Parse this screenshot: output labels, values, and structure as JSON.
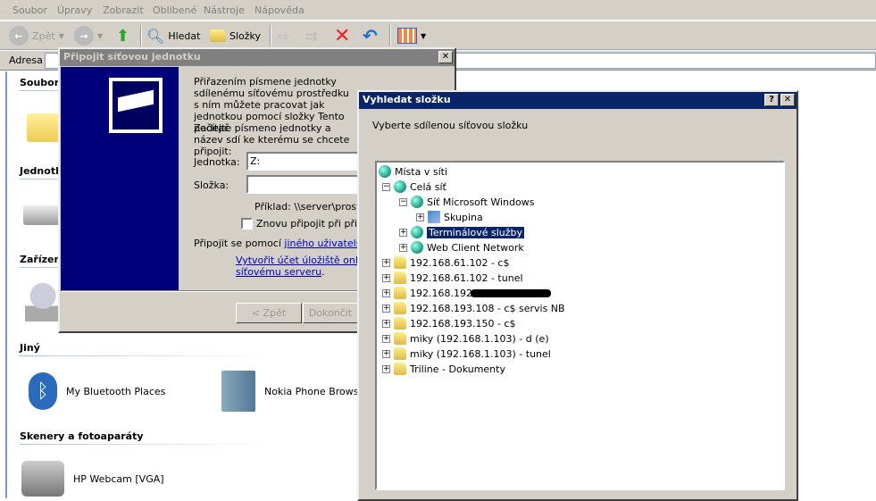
{
  "menu": [
    "Soubor",
    "Úpravy",
    "Zobrazit",
    "Oblíbené",
    "Nástroje",
    "Nápověda"
  ],
  "toolbar": {
    "back": "Zpět",
    "search": "Hledat",
    "folders": "Složky"
  },
  "address": {
    "label": "Adresa"
  },
  "explorer": {
    "groups": [
      "Soubory",
      "Jednotk",
      "Zařízení",
      "Jiný",
      "Skenery a fotoaparáty"
    ],
    "items": [
      "My Bluetooth Places",
      "Nokia Phone Browser",
      "HP Webcam [VGA]"
    ]
  },
  "connect_dialog": {
    "title": "Připojit síťovou jednotku",
    "intro": "Přiřazením písmene jednotky sdílenému síťovému prostředku s ním můžete pracovat jak jednotkou pomocí složky Tento počítač",
    "instruction": "Zadejte písmeno jednotky a název sdí ke kterému se chcete připojit:",
    "drive_label": "Jednotka:",
    "drive_value": "Z:",
    "folder_label": "Složka:",
    "folder_value": "",
    "example": "Příklad: \\\\server\\prostředek",
    "reconnect": "Znovu připojit při přihlá",
    "connect_as_prefix": "Připojit se pomocí ",
    "connect_as_link": "jiného uživatelského",
    "online_link_1": "Vytvořit účet úložiště online",
    "online_link_2": "síťovému serveru",
    "back_button": "< Zpět",
    "finish_button": "Dokončit",
    "close": "✕"
  },
  "browse_dialog": {
    "title": "Vyhledat složku",
    "help": "?",
    "close": "✕",
    "prompt": "Vyberte sdílenou síťovou složku",
    "tree": [
      {
        "label": "Místa v síti",
        "level": 0,
        "exp": "",
        "icon": "network-places"
      },
      {
        "label": "Celá síť",
        "level": 1,
        "exp": "−",
        "icon": "globe"
      },
      {
        "label": "Síť Microsoft Windows",
        "level": 2,
        "exp": "−",
        "icon": "globe"
      },
      {
        "label": "Skupina",
        "level": 3,
        "exp": "+",
        "icon": "workgroup"
      },
      {
        "label": "Terminálové služby",
        "level": 2,
        "exp": "+",
        "icon": "globe",
        "selected": true
      },
      {
        "label": "Web Client Network",
        "level": 2,
        "exp": "+",
        "icon": "globe"
      },
      {
        "label": "192.168.61.102 - c$",
        "level": 1,
        "exp": "+",
        "icon": "share"
      },
      {
        "label": "192.168.61.102 - tunel",
        "level": 1,
        "exp": "+",
        "icon": "share"
      },
      {
        "label": "192.168.192",
        "level": 1,
        "exp": "+",
        "icon": "share",
        "redacted": true
      },
      {
        "label": "192.168.193.108 - c$ servis NB",
        "level": 1,
        "exp": "+",
        "icon": "share"
      },
      {
        "label": "192.168.193.150 - c$",
        "level": 1,
        "exp": "+",
        "icon": "share"
      },
      {
        "label": "miky (192.168.1.103) - d (e)",
        "level": 1,
        "exp": "+",
        "icon": "share"
      },
      {
        "label": "miky (192.168.1.103) - tunel",
        "level": 1,
        "exp": "+",
        "icon": "share"
      },
      {
        "label": "Triline - Dokumenty",
        "level": 1,
        "exp": "+",
        "icon": "share"
      }
    ]
  }
}
